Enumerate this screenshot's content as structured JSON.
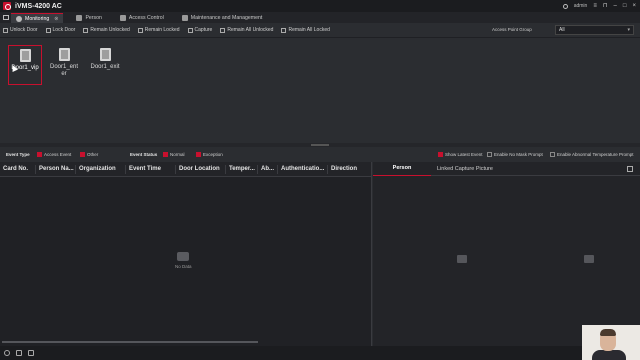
{
  "app": {
    "title": "iVMS-4200 AC",
    "user": "admin",
    "brand_color": "#c8102e"
  },
  "tabs": [
    {
      "label": "Monitoring",
      "active": true
    },
    {
      "label": "Person"
    },
    {
      "label": "Access Control"
    },
    {
      "label": "Maintenance and Management"
    }
  ],
  "toolbar": {
    "unlock": "Unlock Door",
    "lock": "Lock Door",
    "remain_unlocked": "Remain Unlocked",
    "remain_locked": "Remain Locked",
    "capture": "Capture",
    "remain_all_unlocked": "Remain All Unlocked",
    "remain_all_locked": "Remain All Locked",
    "access_point_group_label": "Access Point Group",
    "access_point_group_value": "All"
  },
  "doors": [
    {
      "label": "Door1_vip",
      "selected": true
    },
    {
      "label": "Door1_enter"
    },
    {
      "label": "Door1_exit"
    }
  ],
  "filters": {
    "event_type_label": "Event Type",
    "access_event": "Access Event",
    "other": "Other",
    "event_status_label": "Event Status",
    "normal": "Normal",
    "exception": "Exception",
    "show_latest": "Show Latest Event",
    "no_mask": "Enable No Mask Prompt",
    "abnormal_temp": "Enable Abnormal Temperature Prompt"
  },
  "table": {
    "columns": [
      "Card No.",
      "Person Na...",
      "Organization",
      "Event Time",
      "Door Location",
      "Temper...",
      "Ab...",
      "Authenticatio...",
      "Direction"
    ],
    "empty_text": "No Data"
  },
  "detail": {
    "tab_person": "Person",
    "tab_capture": "Linked Capture Picture"
  }
}
